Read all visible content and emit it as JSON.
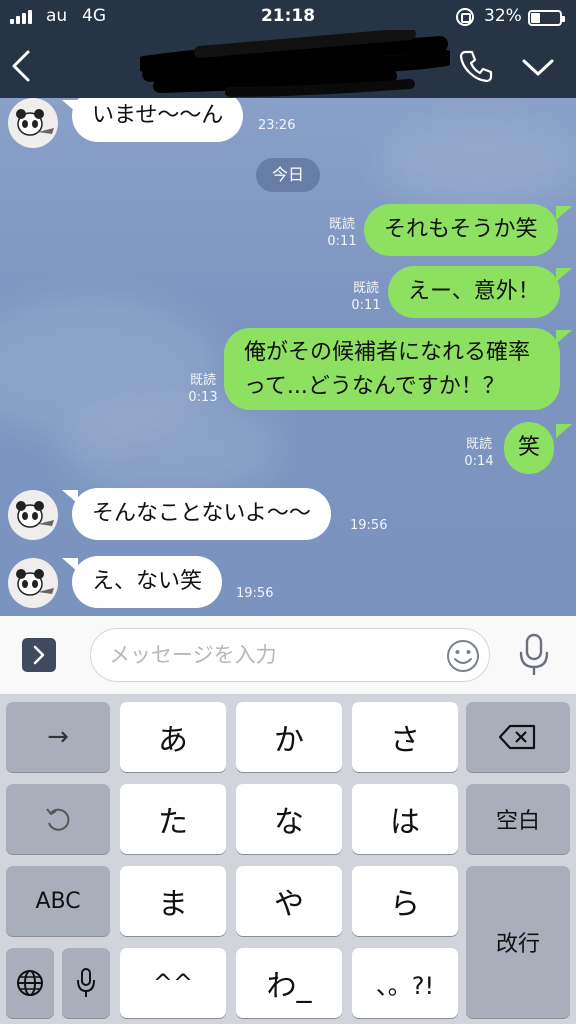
{
  "status": {
    "carrier": "au",
    "network": "4G",
    "time": "21:18",
    "battery": "32%"
  },
  "header": {
    "contact_name_redacted": true
  },
  "chat": {
    "messages": [
      {
        "side": "in",
        "text": "いませ〜〜ん",
        "time": "23:26"
      },
      {
        "side": "date",
        "text": "今日"
      },
      {
        "side": "out",
        "text": "それもそうか笑",
        "read": "既読",
        "time": "0:11"
      },
      {
        "side": "out",
        "text": "えー、意外！",
        "read": "既読",
        "time": "0:11"
      },
      {
        "side": "out",
        "text_line1": "俺がその候補者になれる確率",
        "text_line2": "って...どうなんですか！？",
        "read": "既読",
        "time": "0:13"
      },
      {
        "side": "out",
        "text": "笑",
        "read": "既読",
        "time": "0:14"
      },
      {
        "side": "in",
        "text": "そんなことないよ〜〜",
        "time": "19:56"
      },
      {
        "side": "in",
        "text": "え、ない笑",
        "time": "19:56"
      }
    ]
  },
  "input": {
    "placeholder": "メッセージを入力",
    "value": ""
  },
  "keyboard": {
    "arrow": "→",
    "kana_row1": [
      "あ",
      "か",
      "さ"
    ],
    "kana_row2": [
      "た",
      "な",
      "は"
    ],
    "kana_row3": [
      "ま",
      "や",
      "ら"
    ],
    "kana_row4": [
      "^^",
      "わ_",
      "、。?!"
    ],
    "space": "空白",
    "abc": "ABC",
    "enter": "改行"
  },
  "colors": {
    "header": "#263445",
    "chat_bg": "#7e98c2",
    "sent_bubble": "#8ee060",
    "received_bubble": "#ffffff",
    "keyboard_bg": "#d2d4dc"
  }
}
